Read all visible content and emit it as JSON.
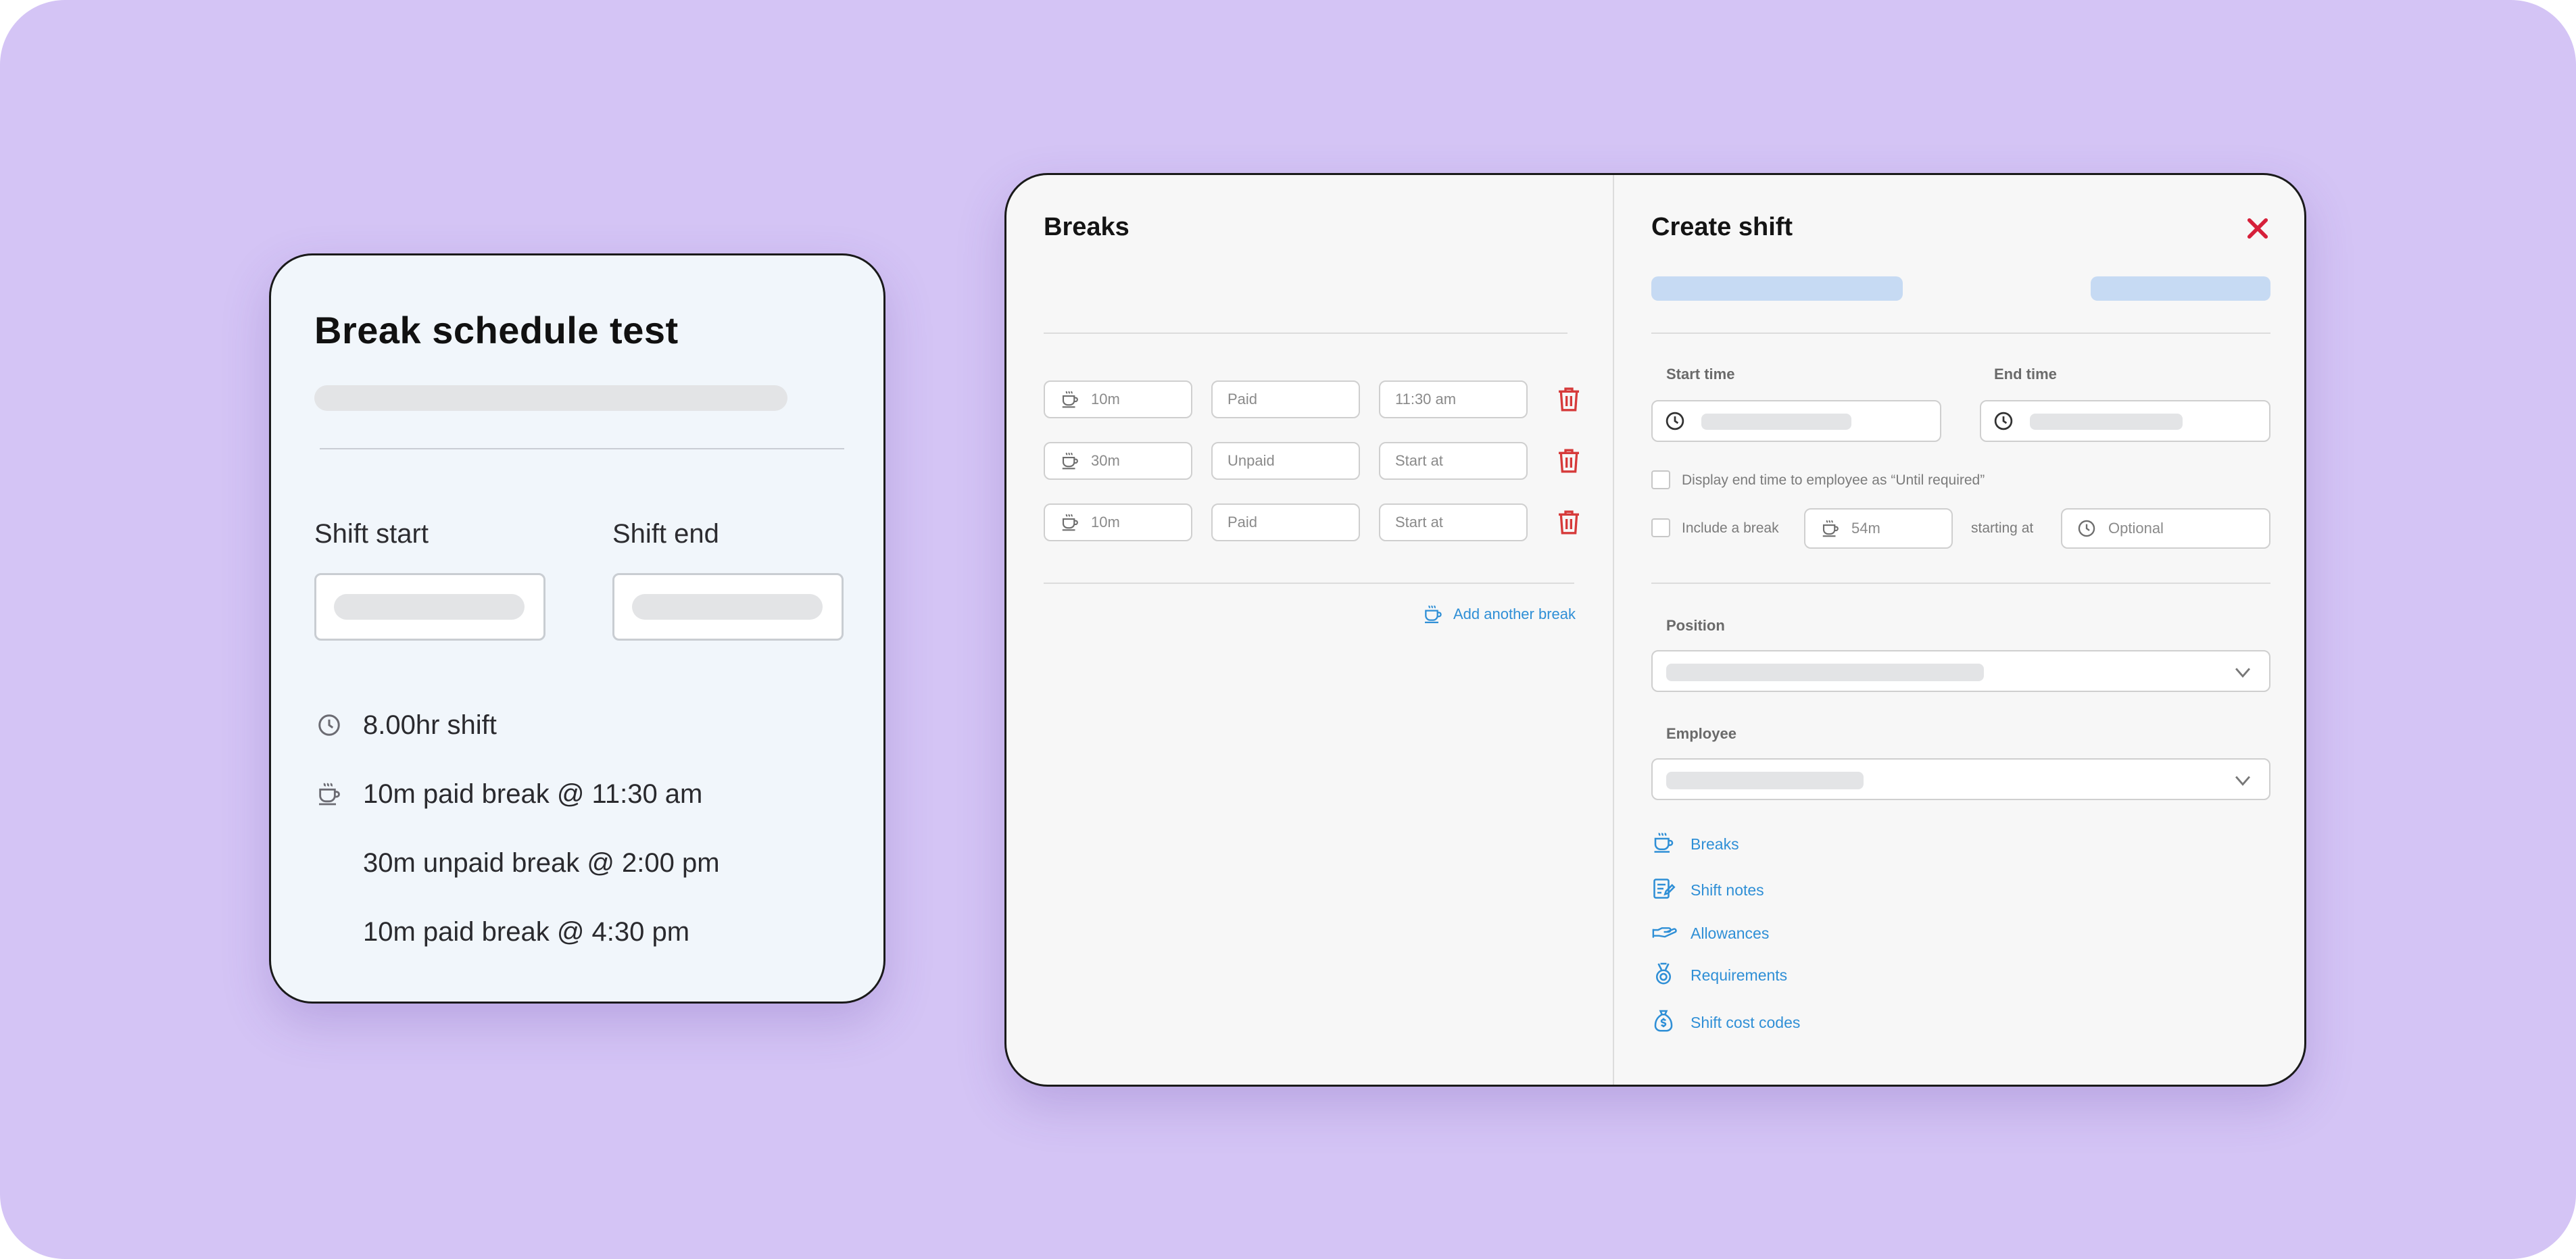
{
  "summary": {
    "title": "Break schedule test",
    "shift_start_label": "Shift start",
    "shift_end_label": "Shift end",
    "shift_length": "8.00hr shift",
    "breaks": [
      "10m paid break @ 11:30 am",
      "30m unpaid break @ 2:00 pm",
      "10m paid break @ 4:30 pm"
    ]
  },
  "breaks_panel": {
    "title": "Breaks",
    "rows": [
      {
        "duration": "10m",
        "type": "Paid",
        "start": "11:30 am"
      },
      {
        "duration": "30m",
        "type": "Unpaid",
        "start": "Start at"
      },
      {
        "duration": "10m",
        "type": "Paid",
        "start": "Start at"
      }
    ],
    "add_break_label": "Add another break"
  },
  "create_shift": {
    "title": "Create shift",
    "start_time_label": "Start time",
    "end_time_label": "End time",
    "display_end_time_label": "Display end time to employee as “Until required”",
    "include_break_label": "Include a break",
    "break_duration": "54m",
    "starting_at_label": "starting at",
    "optional_placeholder": "Optional",
    "position_label": "Position",
    "employee_label": "Employee",
    "links": [
      "Breaks",
      "Shift notes",
      "Allowances",
      "Requirements",
      "Shift cost codes"
    ]
  },
  "icons": {
    "clock": "clock-icon",
    "coffee": "coffee-cup-icon",
    "trash": "trash-icon",
    "close": "close-icon",
    "chevron": "chevron-down-icon",
    "notes": "notes-icon",
    "allowance": "hand-icon",
    "medal": "medal-icon",
    "money_bag": "money-bag-icon"
  },
  "colors": {
    "background": "#d4c4f5",
    "accent_link": "#2f8fd6",
    "danger": "#d63a3a",
    "close": "#d6203a",
    "placeholder_bar": "#c6daf3"
  }
}
